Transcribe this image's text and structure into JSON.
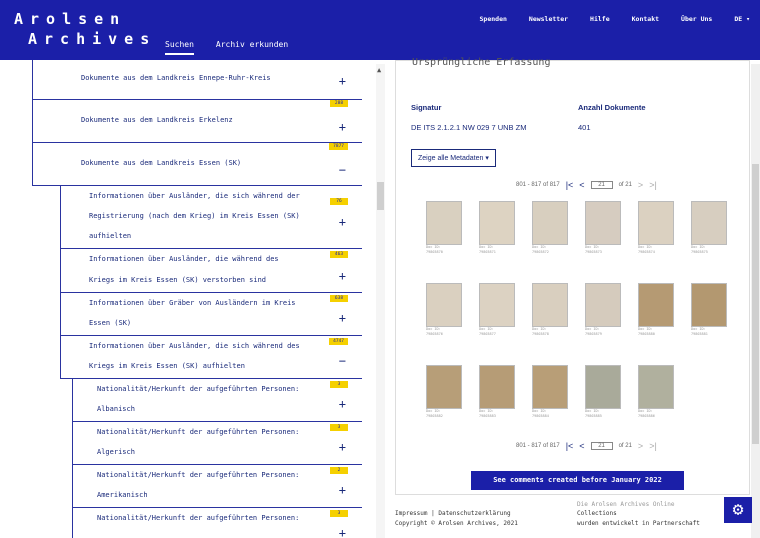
{
  "header": {
    "logo_line1": "Arolsen",
    "logo_line2": "Archives",
    "nav": [
      "Suchen",
      "Archiv erkunden"
    ],
    "top_links": [
      "Spenden",
      "Newsletter",
      "Hilfe",
      "Kontakt",
      "Über Uns",
      "DE ▾"
    ]
  },
  "tree": [
    {
      "label1": "Dokumente aus dem Landkreis Ennepe-Ruhr-Kreis",
      "label2": "",
      "badge": "",
      "toggle": "+"
    },
    {
      "label1": "Dokumente aus dem Landkreis Erkelenz",
      "label2": "",
      "badge": "288",
      "toggle": "+"
    },
    {
      "label1": "Dokumente aus dem Landkreis Essen (SK)",
      "label2": "",
      "badge": "7877",
      "toggle": "−"
    },
    {
      "label1": "Informationen über Ausländer, die sich während der",
      "label2": "Registrierung (nach dem Krieg) im Kreis Essen (SK)",
      "label3": "aufhielten",
      "badge": "76",
      "toggle": "+"
    },
    {
      "label1": "Informationen über Ausländer, die während des",
      "label2": "Kriegs im Kreis Essen (SK) verstorben sind",
      "badge": "463",
      "toggle": "+"
    },
    {
      "label1": "Informationen über Gräber von Ausländern im Kreis",
      "label2": "Essen (SK)",
      "badge": "638",
      "toggle": "+"
    },
    {
      "label1": "Informationen über Ausländer, die sich während des",
      "label2": "Kriegs im Kreis Essen (SK) aufhielten",
      "badge": "4747",
      "toggle": "−"
    },
    {
      "label1": "Nationalität/Herkunft der aufgeführten Personen:",
      "label2": "Albanisch",
      "badge": "3",
      "toggle": "+"
    },
    {
      "label1": "Nationalität/Herkunft der aufgeführten Personen:",
      "label2": "Algerisch",
      "badge": "3",
      "toggle": "+"
    },
    {
      "label1": "Nationalität/Herkunft der aufgeführten Personen:",
      "label2": "Amerikanisch",
      "badge": "2",
      "toggle": "+"
    },
    {
      "label1": "Nationalität/Herkunft der aufgeführten Personen:",
      "label2": "",
      "badge": "3",
      "toggle": "+"
    }
  ],
  "detail": {
    "section_title": "Ursprüngliche Erfassung",
    "signatur_label": "Signatur",
    "signatur_value": "DE ITS 2.1.2.1 NW 029 7 UNB ZM",
    "anzahl_label": "Anzahl Dokumente",
    "anzahl_value": "401",
    "metadata_button": "Zeige alle Metadaten ▾",
    "pager_range": "801 - 817 of 817",
    "pager_page": "21",
    "pager_of": "of 21",
    "comments_button": "See comments created before January 2022"
  },
  "thumbs": [
    {
      "cap1": "Doc ID:",
      "cap2": "79803870",
      "color": "#d9d0c0"
    },
    {
      "cap1": "Doc ID:",
      "cap2": "79803871",
      "color": "#ddd3c2"
    },
    {
      "cap1": "Doc ID:",
      "cap2": "79803872",
      "color": "#d8cfbf"
    },
    {
      "cap1": "Doc ID:",
      "cap2": "79803873",
      "color": "#d6ccc0"
    },
    {
      "cap1": "Doc ID:",
      "cap2": "79803874",
      "color": "#dbd1c1"
    },
    {
      "cap1": "Doc ID:",
      "cap2": "79803875",
      "color": "#d7cec0"
    },
    {
      "cap1": "Doc ID:",
      "cap2": "79803876",
      "color": "#dad0c0"
    },
    {
      "cap1": "Doc ID:",
      "cap2": "79803877",
      "color": "#dcd2c2"
    },
    {
      "cap1": "Doc ID:",
      "cap2": "79803878",
      "color": "#d9cfbf"
    },
    {
      "cap1": "Doc ID:",
      "cap2": "79803879",
      "color": "#d5cbbd"
    },
    {
      "cap1": "Doc ID:",
      "cap2": "79803880",
      "color": "#b59a73"
    },
    {
      "cap1": "Doc ID:",
      "cap2": "79803881",
      "color": "#b39870"
    },
    {
      "cap1": "Doc ID:",
      "cap2": "79803882",
      "color": "#b79e78"
    },
    {
      "cap1": "Doc ID:",
      "cap2": "79803883",
      "color": "#b69c76"
    },
    {
      "cap1": "Doc ID:",
      "cap2": "79803884",
      "color": "#b89e77"
    },
    {
      "cap1": "Doc ID:",
      "cap2": "79803885",
      "color": "#a9aa9a"
    },
    {
      "cap1": "Doc ID:",
      "cap2": "79803886",
      "color": "#b0b09e"
    }
  ],
  "footer": {
    "left1": "Impressum  |  Datenschutzerklärung",
    "left2": "Copyright © Arolsen Archives, 2021",
    "right0": "Die Arolsen Archives Online",
    "right1": "Collections",
    "right2": "wurden entwickelt in Partnerschaft"
  },
  "colors": {
    "brand": "#1b1fa8",
    "badge": "#f5d000"
  }
}
